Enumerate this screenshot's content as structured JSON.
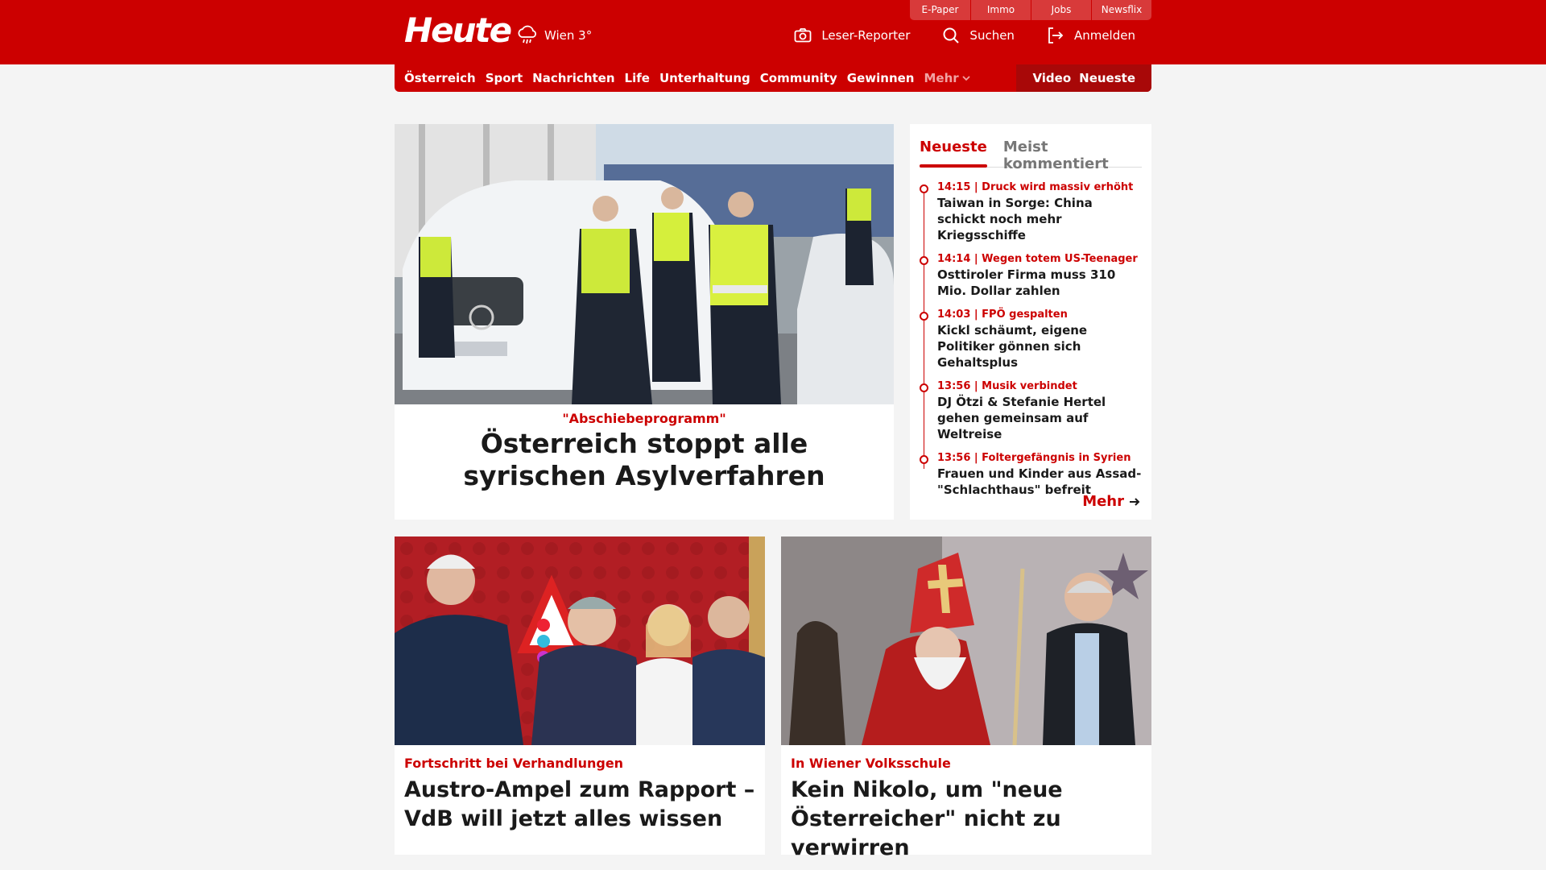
{
  "header": {
    "logo": "Heute",
    "weather": {
      "icon": "rain-cloud-icon",
      "text": "Wien 3°"
    },
    "utility_links": [
      "E-Paper",
      "Immo",
      "Jobs",
      "Newsflix"
    ],
    "actions": [
      {
        "icon": "camera-icon",
        "label": "Leser-Reporter"
      },
      {
        "icon": "search-icon",
        "label": "Suchen"
      },
      {
        "icon": "login-icon",
        "label": "Anmelden"
      }
    ]
  },
  "nav": {
    "items": [
      "Österreich",
      "Sport",
      "Nachrichten",
      "Life",
      "Unterhaltung",
      "Community",
      "Gewinnen"
    ],
    "more": "Mehr",
    "right": [
      "Video",
      "Neueste"
    ]
  },
  "hero": {
    "kicker": "\"Abschiebeprogramm\"",
    "headline": "Österreich stoppt alle syrischen Asylverfahren"
  },
  "sidebar": {
    "tabs": [
      "Neueste",
      "Meist kommentiert"
    ],
    "items": [
      {
        "meta": "14:15 | Druck wird massiv erhöht",
        "title": "Taiwan in Sorge: China schickt noch mehr Kriegsschiffe"
      },
      {
        "meta": "14:14 | Wegen totem US-Teenager",
        "title": "Osttiroler Firma muss 310 Mio. Dollar zahlen"
      },
      {
        "meta": "14:03 | FPÖ gespalten",
        "title": "Kickl schäumt, eigene Politiker gönnen sich Gehaltsplus"
      },
      {
        "meta": "13:56 | Musik verbindet",
        "title": "DJ Ötzi & Stefanie Hertel gehen gemeinsam auf Weltreise"
      },
      {
        "meta": "13:56 | Foltergefängnis in Syrien",
        "title": "Frauen und Kinder aus Assad-\"Schlachthaus\" befreit"
      }
    ],
    "more_label": "Mehr"
  },
  "cards": [
    {
      "kicker": "Fortschritt bei Verhandlungen",
      "title": "Austro-Ampel zum Rapport – VdB will jetzt alles wissen"
    },
    {
      "kicker": "In Wiener Volksschule",
      "title": "Kein Nikolo, um \"neue Österreicher\" nicht zu verwirren"
    }
  ],
  "colors": {
    "brand_red": "#cc0000",
    "dark_red": "#a80808",
    "background": "#f4f4f4"
  }
}
